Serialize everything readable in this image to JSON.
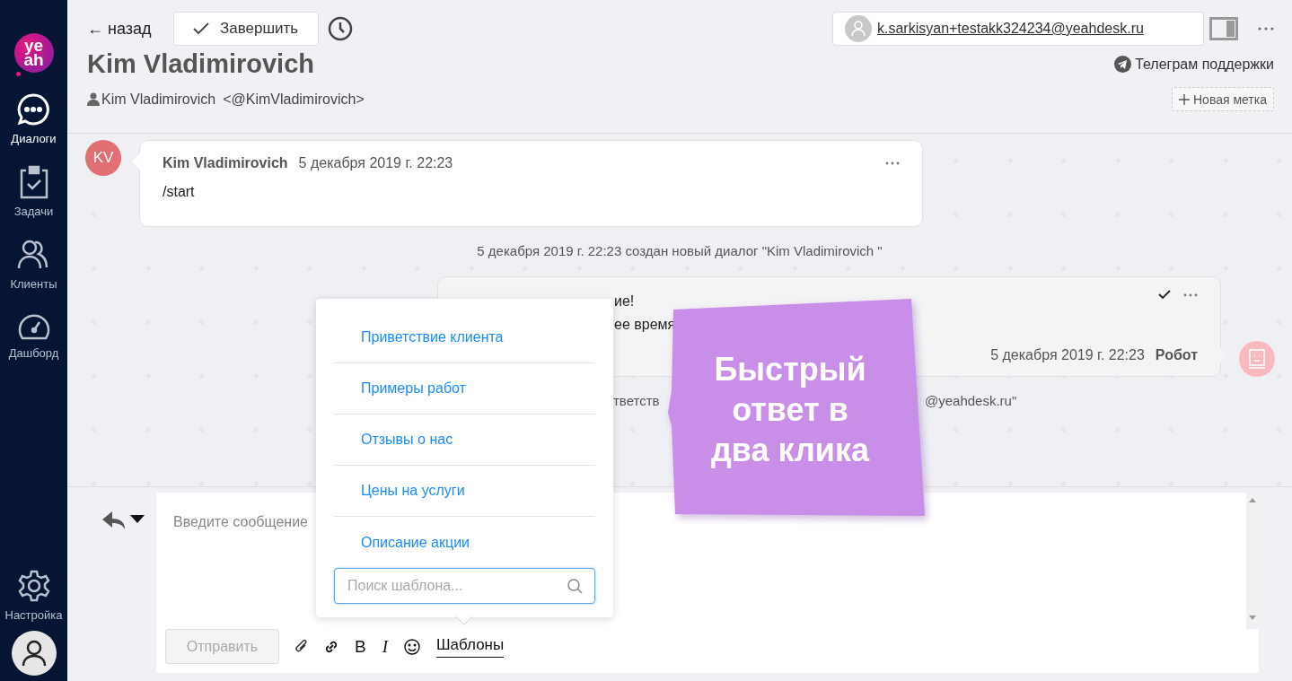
{
  "sidebar": {
    "logo": {
      "lines": [
        "ye",
        "ah"
      ]
    },
    "items": [
      {
        "kind": "chat",
        "label": "Диалоги",
        "selected": true
      },
      {
        "kind": "tasks",
        "label": "Задачи",
        "selected": false
      },
      {
        "kind": "clients",
        "label": "Клиенты",
        "selected": false
      },
      {
        "kind": "dashboard",
        "label": "Дашборд",
        "selected": false
      }
    ],
    "settings": {
      "kind": "settings",
      "label": "Настройка",
      "selected": false
    }
  },
  "header": {
    "back_link": "← назад",
    "finish_button": "Завершить",
    "account_email": "k.sarkisyan+testakk324234@yeahdesk.ru",
    "title": "Kim Vladimirovich",
    "telegram_link": "Телеграм поддержки",
    "contact_name": "Kim Vladimirovich",
    "contact_handle": "<@KimVladimirovich>",
    "new_tag_button": "Новая метка"
  },
  "messages": [
    {
      "kind": "incoming",
      "initials": "KV",
      "author": "Kim Vladimirovich",
      "time": "5 декабря 2019 г. 22:23",
      "text": "/start"
    },
    {
      "kind": "system",
      "fragments": [
        "5 декабря 2019 г. 22:23 создан новый диалог \"Kim Vladimirovich \""
      ]
    },
    {
      "kind": "outgoing",
      "lines": [
        "ие!",
        "ее время"
      ],
      "time": "5 декабря 2019 г. 22:23",
      "author": "Робот",
      "delivered": true
    },
    {
      "kind": "system_partial",
      "fragments": [
        "тветств",
        "@yeahdesk.ru\""
      ]
    }
  ],
  "composer": {
    "placeholder": "Введите сообщение",
    "send_button": {
      "label": "Отправить",
      "disabled": true
    },
    "format_buttons": [
      "B",
      "I"
    ],
    "templates_link": "Шаблоны"
  },
  "templates_popup": {
    "items": [
      "Приветствие клиента",
      "Примеры работ",
      "Отзывы о нас",
      "Цены на услуги",
      "Описание акции"
    ],
    "search_placeholder": "Поиск шаблона..."
  },
  "callout": {
    "text": "Быстрый ответ в два клика"
  }
}
